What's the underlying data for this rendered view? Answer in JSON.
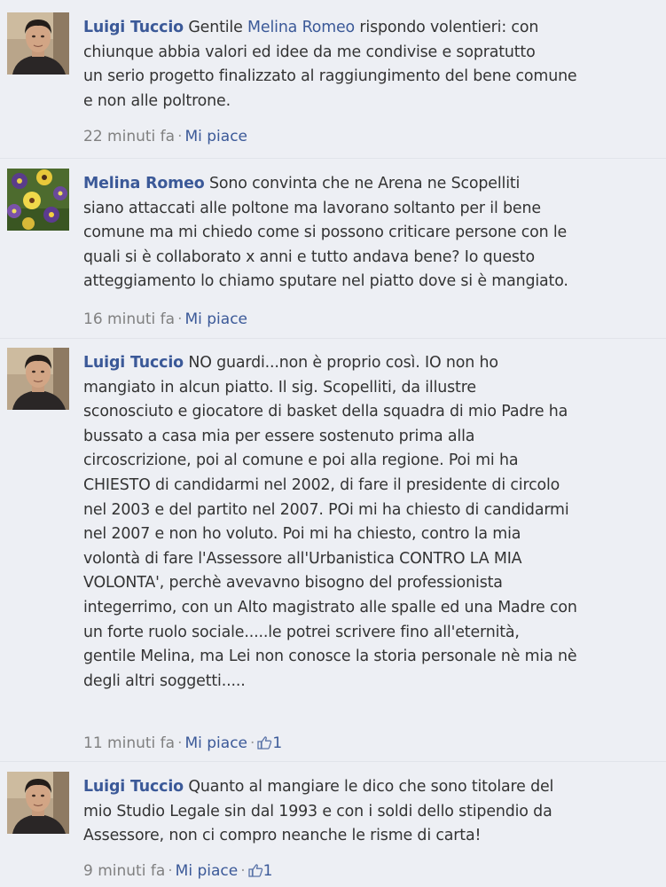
{
  "comments": [
    {
      "author": "Luigi Tuccio",
      "avatar": "man-portrait",
      "text_lines": [
        {
          "pre": " Gentile ",
          "mention": "Melina Romeo",
          "post": " rispondo volentieri: con"
        },
        "chiunque abbia valori ed idee da me condivise e sopratutto",
        "un serio progetto finalizzato al raggiungimento del bene comune",
        "e non alle poltrone."
      ],
      "time": "22 minuti fa",
      "like_label": "Mi piace",
      "likes": ""
    },
    {
      "author": "Melina Romeo",
      "avatar": "flowers-photo",
      "text_lines": [
        " Sono convinta che ne Arena ne Scopelliti",
        "siano attaccati alle poltone ma lavorano soltanto per il bene",
        "comune ma mi chiedo come si possono criticare persone con le",
        "quali si è collaborato x anni e tutto andava bene? Io questo",
        "atteggiamento lo chiamo sputare nel piatto dove si è mangiato."
      ],
      "time": "16 minuti fa",
      "like_label": "Mi piace",
      "likes": ""
    },
    {
      "author": "Luigi Tuccio",
      "avatar": "man-portrait",
      "text_lines": [
        " NO guardi...non è proprio così. IO non ho",
        "mangiato in alcun piatto. Il sig. Scopelliti, da illustre",
        "sconosciuto e giocatore di basket della squadra di mio Padre ha",
        "bussato a casa mia per essere sostenuto prima alla",
        "circoscrizione, poi al comune e poi alla regione. Poi mi ha",
        "CHIESTO di candidarmi nel 2002, di fare il presidente di circolo",
        "nel 2003 e del partito nel 2007. POi mi ha chiesto di candidarmi",
        "nel 2007 e non ho voluto. Poi mi ha chiesto, contro la mia",
        "volontà di fare l'Assessore all'Urbanistica CONTRO LA MIA",
        "VOLONTA', perchè avevavno bisogno del professionista",
        "integerrimo, con un Alto magistrato alle spalle ed una Madre con",
        "un forte ruolo sociale.....le potrei scrivere fino all'eternità,",
        "gentile Melina, ma Lei non conosce la storia personale nè mia nè",
        "degli altri soggetti....."
      ],
      "time": "11 minuti fa",
      "like_label": "Mi piace",
      "likes": "1"
    },
    {
      "author": "Luigi Tuccio",
      "avatar": "man-portrait",
      "text_lines": [
        " Quanto al mangiare le dico che sono titolare del",
        "mio Studio Legale sin dal 1993 e con i soldi dello stipendio da",
        "Assessore, non ci compro neanche le risme di carta!"
      ],
      "time": "9 minuti fa",
      "like_label": "Mi piace",
      "likes": "1"
    }
  ],
  "meta_separator": "·",
  "colors": {
    "background": "#edeff4",
    "author": "#3b5998",
    "link": "#3b5998",
    "text": "#333333",
    "meta": "#808080"
  }
}
